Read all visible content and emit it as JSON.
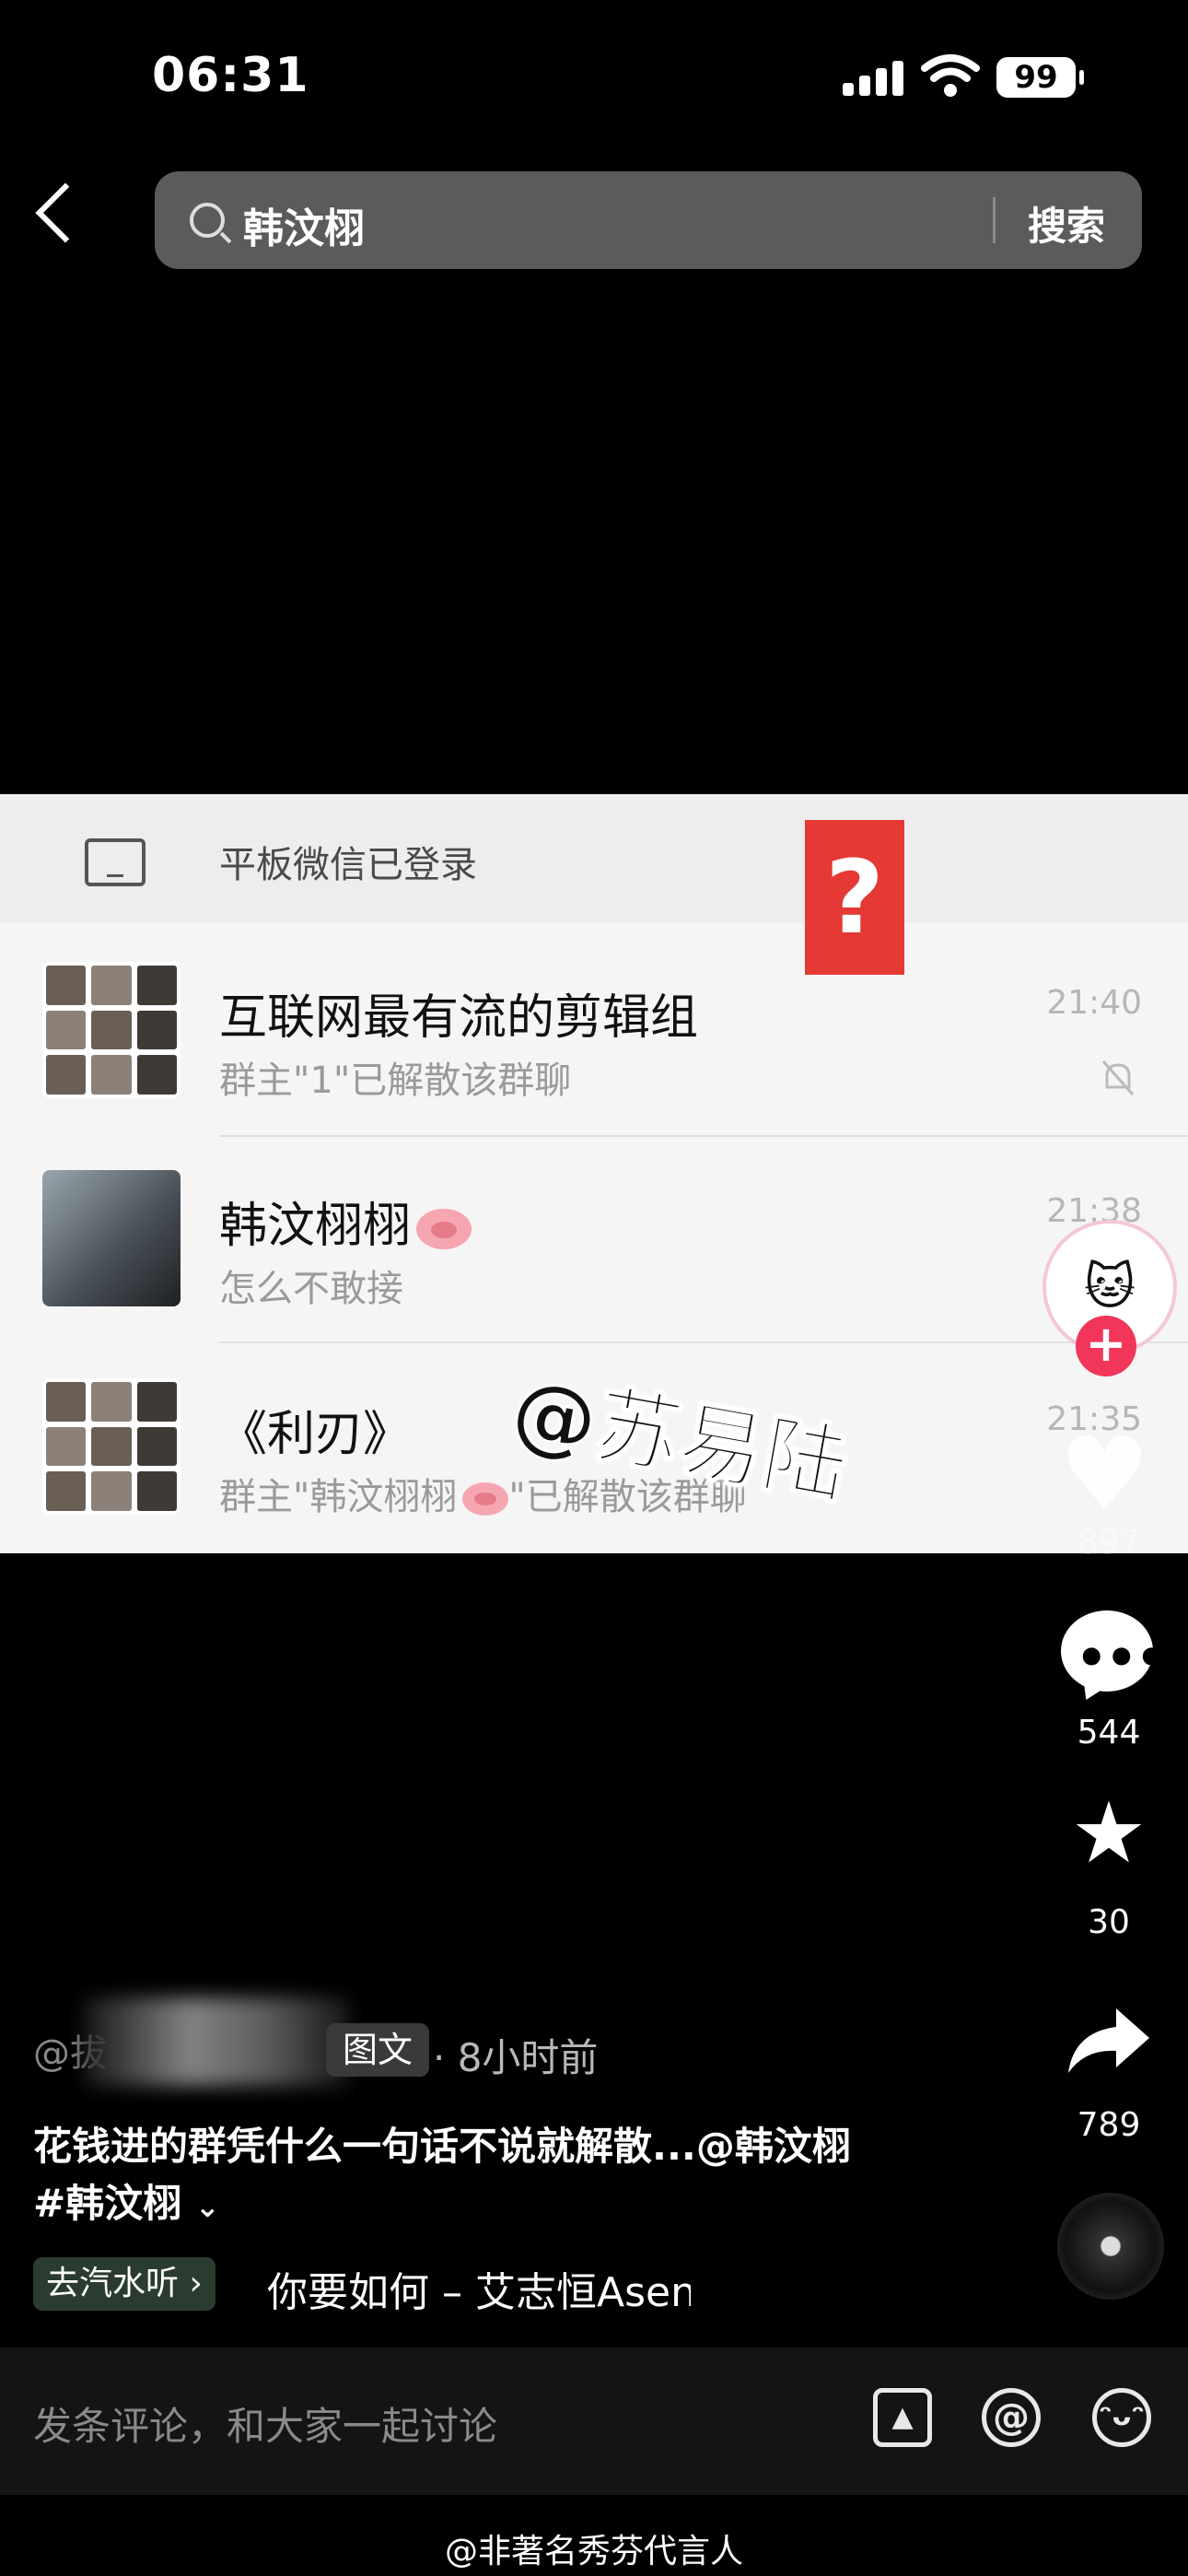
{
  "status_bar": {
    "time": "06:31",
    "battery": "99"
  },
  "search": {
    "query": "韩汶栩",
    "button_label": "搜索"
  },
  "chat_panel": {
    "device_notice": "平板微信已登录",
    "question_mark": "?",
    "chats": [
      {
        "name": "互联网最有流的剪辑组",
        "message": "群主\"1\"已解散该群聊",
        "time": "21:40",
        "muted": true
      },
      {
        "name": "韩汶栩栩",
        "message": "怎么不敢接",
        "time": "21:38"
      },
      {
        "name": "《利刃》",
        "message_prefix": "群主\"韩汶栩栩",
        "message_suffix": "\"已解散该群聊",
        "time": "21:35"
      }
    ],
    "watermark": "@苏易陆"
  },
  "actions": {
    "likes": "897",
    "comments": "544",
    "favorites": "30",
    "shares": "789"
  },
  "post": {
    "author_visible": "@拔",
    "type_tag": "图文",
    "time_ago": "· 8小时前",
    "caption": "花钱进的群凭什么一句话不说就解散...@韩汶栩",
    "hashtag": "#韩汶栩",
    "music_button": "去汽水听",
    "music_title": "你要如何 – 艾志恒Asen"
  },
  "comment_bar": {
    "placeholder": "发条评论，和大家一起讨论"
  },
  "weibo_watermark": "@非著名秀芬代言人",
  "icons": {
    "back": "back-chevron-icon",
    "search": "search-icon",
    "tablet": "tablet-icon",
    "mute": "mute-bell-icon",
    "comment": "comment-icon",
    "favorite": "star-icon",
    "share": "share-icon",
    "image": "image-icon",
    "mention": "at-icon",
    "emoji": "emoji-icon"
  },
  "colors": {
    "follow_red": "#f2365a",
    "question_red": "#e53935",
    "panel_bg": "#f5f5f5"
  }
}
